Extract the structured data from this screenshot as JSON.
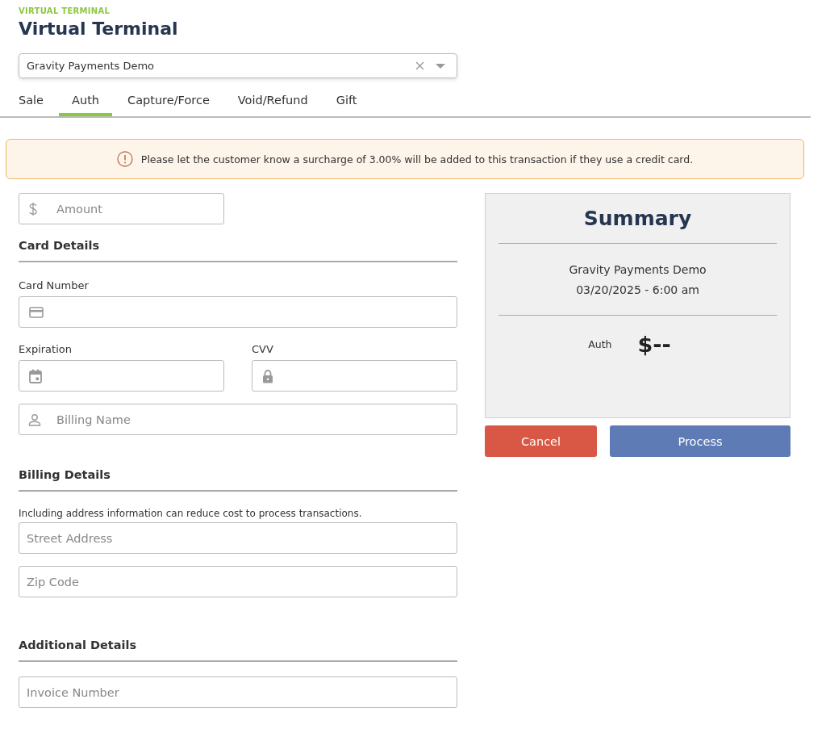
{
  "header": {
    "eyebrow": "VIRTUAL TERMINAL",
    "title": "Virtual Terminal"
  },
  "merchant_select": {
    "value": "Gravity Payments Demo"
  },
  "tabs": [
    {
      "label": "Sale",
      "selected": false
    },
    {
      "label": "Auth",
      "selected": true
    },
    {
      "label": "Capture/Force",
      "selected": false
    },
    {
      "label": "Void/Refund",
      "selected": false
    },
    {
      "label": "Gift",
      "selected": false
    }
  ],
  "notice": {
    "text": "Please let the customer know a surcharge of 3.00% will be added to this transaction if they use a credit card."
  },
  "amount": {
    "placeholder": "Amount"
  },
  "card_details": {
    "heading": "Card Details",
    "card_number": {
      "label": "Card Number"
    },
    "expiration": {
      "label": "Expiration"
    },
    "cvv": {
      "label": "CVV"
    },
    "billing_name": {
      "placeholder": "Billing Name"
    }
  },
  "billing_details": {
    "heading": "Billing Details",
    "hint": "Including address information can reduce cost to process transactions.",
    "street": {
      "placeholder": "Street Address"
    },
    "zip": {
      "placeholder": "Zip Code"
    }
  },
  "additional_details": {
    "heading": "Additional Details",
    "invoice": {
      "placeholder": "Invoice Number"
    }
  },
  "summary": {
    "title": "Summary",
    "merchant": "Gravity Payments Demo",
    "datetime": "03/20/2025 - 6:00 am",
    "type": "Auth",
    "total": "$--"
  },
  "buttons": {
    "cancel": "Cancel",
    "process": "Process"
  }
}
